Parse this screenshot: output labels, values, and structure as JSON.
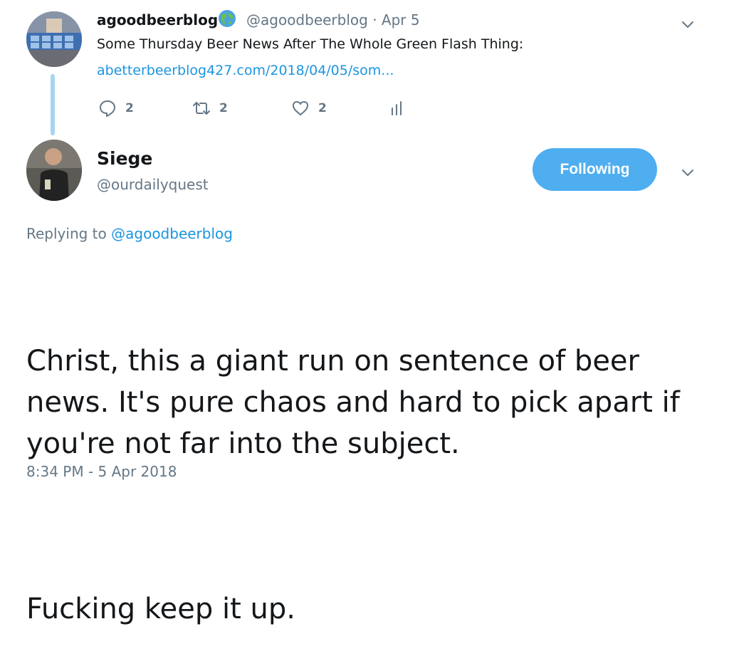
{
  "parent_tweet": {
    "display_name": "agoodbeerblog",
    "name_badge_icon": "globe-emoji",
    "handle_date": "@agoodbeerblog · Apr 5",
    "text": "Some Thursday Beer News After The Whole Green Flash Thing:",
    "link": "abetterbeerblog427.com/2018/04/05/som...",
    "actions": {
      "replies": "2",
      "retweets": "2",
      "likes": "2"
    }
  },
  "reply_tweet": {
    "display_name": "Siege",
    "handle": "@ourdailyquest",
    "follow_label": "Following",
    "replying_to_prefix": "Replying to ",
    "replying_to_handle": "@agoodbeerblog",
    "body": [
      "Christ, this a giant run on sentence of beer\nnews. It's pure chaos and hard to pick apart if\nyou're not far into the subject.",
      "Fucking keep it up."
    ],
    "timestamp": "8:34 PM - 5 Apr 2018"
  },
  "colors": {
    "accent": "#1b95e0",
    "follow_button": "#4eaef0",
    "muted": "#657786",
    "thread_line": "#a8d4f2"
  }
}
